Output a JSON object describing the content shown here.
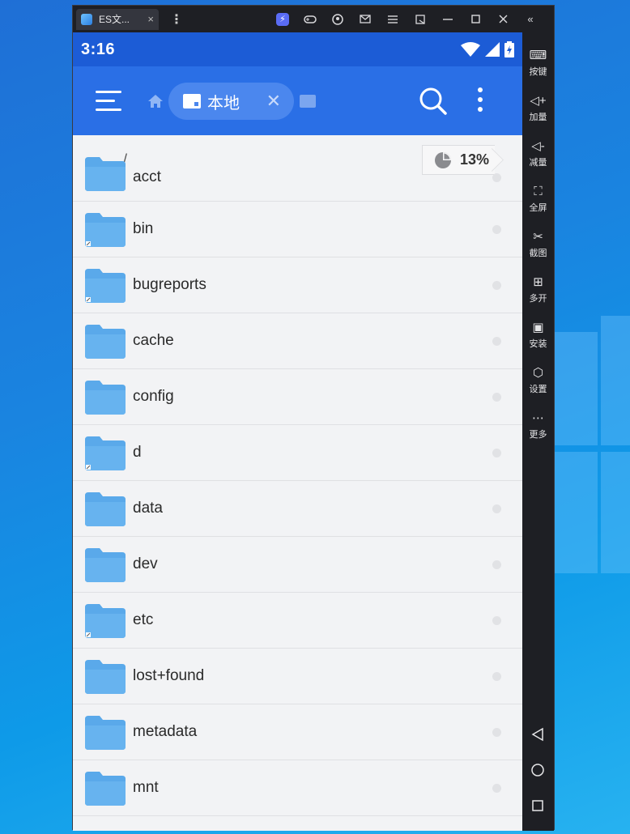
{
  "emulator": {
    "tab_title": "ES文...",
    "tab_close": "×",
    "menu": "⋮",
    "collapse": "«"
  },
  "status": {
    "time": "3:16"
  },
  "appbar": {
    "location_label": "本地",
    "close": "✕"
  },
  "path": {
    "current": "/",
    "usage": "13%"
  },
  "files": [
    {
      "name": "acct",
      "link": false
    },
    {
      "name": "bin",
      "link": true
    },
    {
      "name": "bugreports",
      "link": true
    },
    {
      "name": "cache",
      "link": false
    },
    {
      "name": "config",
      "link": false
    },
    {
      "name": "d",
      "link": true
    },
    {
      "name": "data",
      "link": false
    },
    {
      "name": "dev",
      "link": false
    },
    {
      "name": "etc",
      "link": true
    },
    {
      "name": "lost+found",
      "link": false
    },
    {
      "name": "metadata",
      "link": false
    },
    {
      "name": "mnt",
      "link": false
    }
  ],
  "sidebar": [
    {
      "label": "按键",
      "icon": "keyboard-icon"
    },
    {
      "label": "加量",
      "icon": "volume-up-icon"
    },
    {
      "label": "减量",
      "icon": "volume-down-icon"
    },
    {
      "label": "全屏",
      "icon": "fullscreen-icon"
    },
    {
      "label": "截图",
      "icon": "scissors-icon"
    },
    {
      "label": "多开",
      "icon": "multi-instance-icon"
    },
    {
      "label": "安装",
      "icon": "apk-install-icon"
    },
    {
      "label": "设置",
      "icon": "settings-icon"
    },
    {
      "label": "更多",
      "icon": "more-icon"
    }
  ],
  "colors": {
    "appbar": "#2a6fe6",
    "statusbar": "#1c5cd6",
    "folder": "#5aa9ea",
    "chip": "#4b87ee"
  }
}
